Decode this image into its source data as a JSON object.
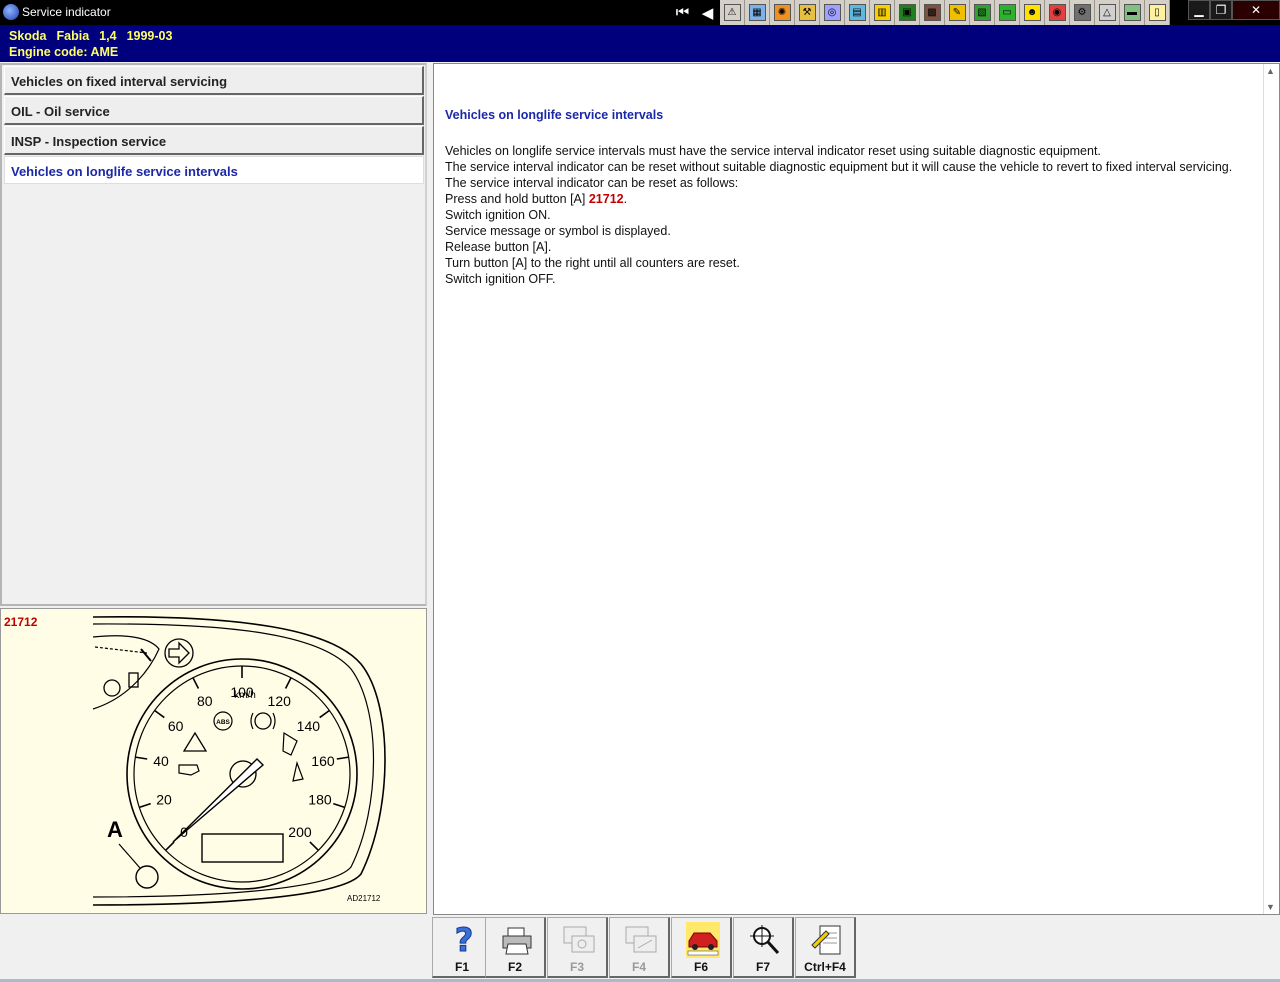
{
  "window": {
    "title": "Service indicator"
  },
  "toolbar": {
    "buttons": [
      {
        "name": "first-page-icon",
        "glyph": "⏮",
        "style": "dark"
      },
      {
        "name": "previous-page-icon",
        "glyph": "◀",
        "style": "dark"
      },
      {
        "name": "warning-icon",
        "glyph": "⚠",
        "style": "light"
      },
      {
        "name": "diagram-icon",
        "glyph": "▦",
        "style": "light"
      },
      {
        "name": "engine-icon",
        "glyph": "✺",
        "style": "light"
      },
      {
        "name": "tools-icon",
        "glyph": "⚒",
        "style": "light"
      },
      {
        "name": "wheel-icon",
        "glyph": "◎",
        "style": "light"
      },
      {
        "name": "manual-icon",
        "glyph": "▤",
        "style": "light"
      },
      {
        "name": "adjustment-icon",
        "glyph": "▥",
        "style": "light"
      },
      {
        "name": "lift-icon",
        "glyph": "▣",
        "style": "light"
      },
      {
        "name": "ramp-icon",
        "glyph": "▩",
        "style": "light"
      },
      {
        "name": "timing-icon",
        "glyph": "✎",
        "style": "light"
      },
      {
        "name": "fuses-icon",
        "glyph": "▧",
        "style": "light"
      },
      {
        "name": "bus-icon",
        "glyph": "▭",
        "style": "light"
      },
      {
        "name": "airbag-icon",
        "glyph": "☻",
        "style": "light"
      },
      {
        "name": "brakes-icon",
        "glyph": "◉",
        "style": "light"
      },
      {
        "name": "gearbox-icon",
        "glyph": "⚙",
        "style": "light"
      },
      {
        "name": "triangle-icon",
        "glyph": "△",
        "style": "light"
      },
      {
        "name": "battery-icon",
        "glyph": "▬",
        "style": "light"
      },
      {
        "name": "notes-icon",
        "glyph": "▯",
        "style": "light"
      }
    ],
    "colors": [
      "#0a0a0a",
      "#0a0a0a",
      "#d4d0c8",
      "#7cb2e8",
      "#f09020",
      "#e8c040",
      "#a0a0ff",
      "#60b8e0",
      "#f8d000",
      "#208020",
      "#805040",
      "#f0c000",
      "#30a030",
      "#30b030",
      "#ffe000",
      "#e04040",
      "#707070",
      "#d0d0d0",
      "#80c080",
      "#fff0a0"
    ]
  },
  "window_controls": {
    "minimize": "▁",
    "maximize": "❐",
    "close": "✕"
  },
  "vehicle": {
    "make": "Skoda",
    "model": "Fabia",
    "engine_size": "1,4",
    "years": "1999-03",
    "engine_code": "Engine code: AME"
  },
  "nav": {
    "items": [
      {
        "label": "Vehicles on fixed interval servicing",
        "active": false
      },
      {
        "label": "OIL - Oil service",
        "active": false
      },
      {
        "label": "INSP - Inspection service",
        "active": false
      },
      {
        "label": "Vehicles on longlife service intervals",
        "active": true
      }
    ]
  },
  "illustration": {
    "ref": "21712",
    "code": "AD21712",
    "button_label": "A",
    "unit": "km/h",
    "speed_labels": [
      "0",
      "20",
      "40",
      "60",
      "80",
      "100",
      "120",
      "140",
      "160",
      "180",
      "200"
    ],
    "abs_label": "ABS"
  },
  "content": {
    "heading": "Vehicles on longlife service intervals",
    "lines": [
      "Vehicles on longlife service intervals must have the service interval indicator reset using suitable diagnostic equipment.",
      "The service interval indicator can be reset without suitable diagnostic equipment but it will cause the vehicle to revert to fixed interval servicing.",
      "The service interval indicator can be reset as follows:",
      "Press and hold button [A]",
      "Switch ignition ON.",
      "Service message or symbol is displayed.",
      "Release button [A].",
      "Turn button [A] to the right until all counters are reset.",
      "Switch ignition OFF."
    ],
    "press_ref": "21712",
    "press_suffix": "."
  },
  "function_keys": [
    {
      "label": "F1",
      "name": "help-icon",
      "disabled": false
    },
    {
      "label": "F2",
      "name": "print-icon",
      "disabled": false
    },
    {
      "label": "F3",
      "name": "copy-diagram-icon",
      "disabled": true
    },
    {
      "label": "F4",
      "name": "paste-diagram-icon",
      "disabled": true
    },
    {
      "label": "F6",
      "name": "vehicle-service-icon",
      "disabled": false
    },
    {
      "label": "F7",
      "name": "magnifier-icon",
      "disabled": false
    },
    {
      "label": "Ctrl+F4",
      "name": "notepad-icon",
      "disabled": false
    }
  ]
}
